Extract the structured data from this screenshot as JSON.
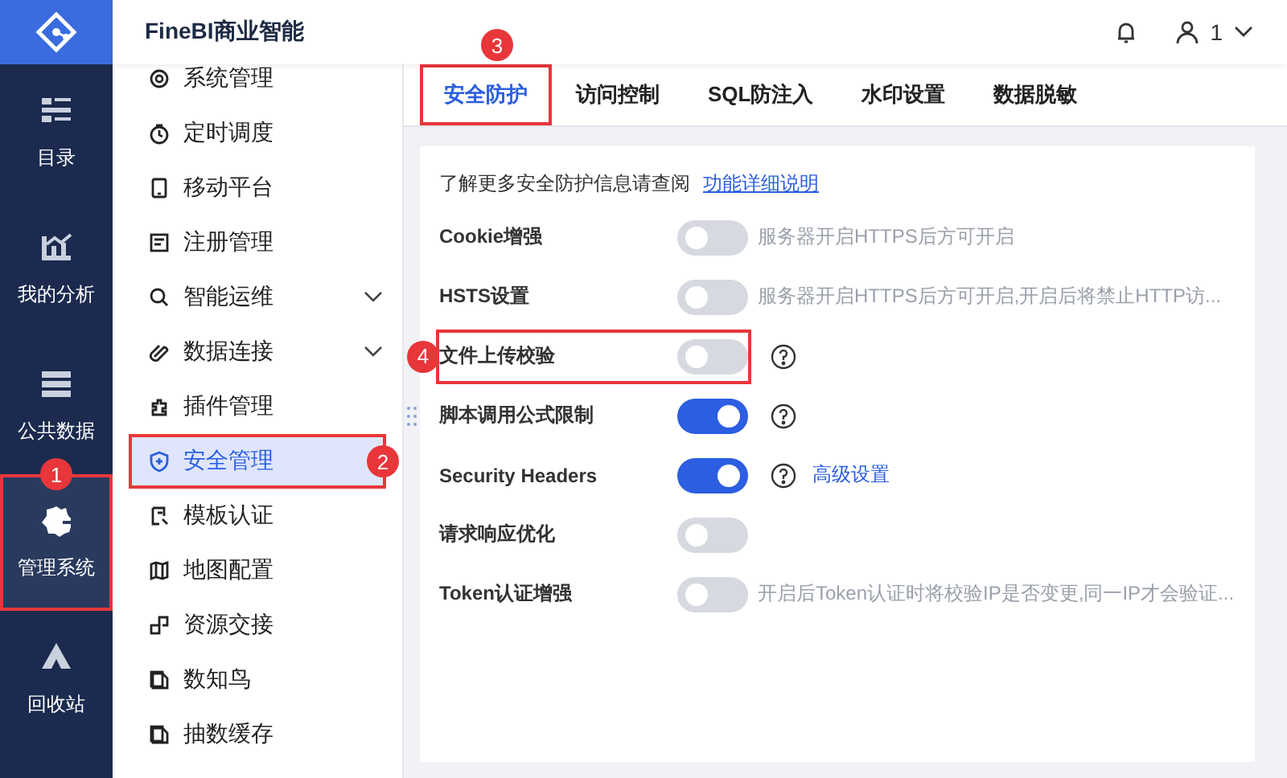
{
  "app": {
    "title": "FineBI商业智能"
  },
  "rail": [
    {
      "label": "目录",
      "selected": false,
      "highlighted": false
    },
    {
      "label": "我的分析",
      "selected": false,
      "highlighted": false
    },
    {
      "label": "公共数据",
      "selected": false,
      "highlighted": false
    },
    {
      "label": "管理系统",
      "selected": true,
      "highlighted": true,
      "badge": "1"
    },
    {
      "label": "回收站",
      "selected": false,
      "highlighted": false
    }
  ],
  "menu": [
    {
      "label": "系统管理",
      "kind": "page",
      "selected": false,
      "highlighted": false
    },
    {
      "label": "定时调度",
      "kind": "page",
      "selected": false,
      "highlighted": false
    },
    {
      "label": "移动平台",
      "kind": "page",
      "selected": false,
      "highlighted": false
    },
    {
      "label": "注册管理",
      "kind": "page",
      "selected": false,
      "highlighted": false
    },
    {
      "label": "智能运维",
      "kind": "group",
      "selected": false,
      "highlighted": false
    },
    {
      "label": "数据连接",
      "kind": "group",
      "selected": false,
      "highlighted": false
    },
    {
      "label": "插件管理",
      "kind": "page",
      "selected": false,
      "highlighted": false
    },
    {
      "label": "安全管理",
      "kind": "page",
      "selected": true,
      "highlighted": true,
      "badge": "2"
    },
    {
      "label": "模板认证",
      "kind": "page",
      "selected": false,
      "highlighted": false
    },
    {
      "label": "地图配置",
      "kind": "page",
      "selected": false,
      "highlighted": false
    },
    {
      "label": "资源交接",
      "kind": "page",
      "selected": false,
      "highlighted": false
    },
    {
      "label": "数知鸟",
      "kind": "page",
      "selected": false,
      "highlighted": false
    },
    {
      "label": "抽数缓存",
      "kind": "page",
      "selected": false,
      "highlighted": false
    }
  ],
  "user": {
    "name": "1"
  },
  "tabs": [
    {
      "label": "安全防护",
      "selected": true,
      "highlighted": true,
      "badge": "3"
    },
    {
      "label": "访问控制",
      "selected": false,
      "highlighted": false
    },
    {
      "label": "SQL防注入",
      "selected": false,
      "highlighted": false
    },
    {
      "label": "水印设置",
      "selected": false,
      "highlighted": false
    },
    {
      "label": "数据脱敏",
      "selected": false,
      "highlighted": false
    }
  ],
  "intro": {
    "text": "了解更多安全防护信息请查阅",
    "link": "功能详细说明"
  },
  "settings": [
    {
      "label": "Cookie增强",
      "on": false,
      "help": false,
      "highlighted": false,
      "hint": "服务器开启HTTPS后方可开启"
    },
    {
      "label": "HSTS设置",
      "on": false,
      "help": false,
      "highlighted": false,
      "hint": "服务器开启HTTPS后方可开启,开启后将禁止HTTP访..."
    },
    {
      "label": "文件上传校验",
      "on": false,
      "help": true,
      "highlighted": true,
      "badge": "4"
    },
    {
      "label": "脚本调用公式限制",
      "on": true,
      "help": true,
      "highlighted": false
    },
    {
      "label": "Security Headers",
      "on": true,
      "help": true,
      "highlighted": false,
      "link": "高级设置"
    },
    {
      "label": "请求响应优化",
      "on": false,
      "help": false,
      "highlighted": false
    },
    {
      "label": "Token认证增强",
      "on": false,
      "help": false,
      "highlighted": false,
      "hint": "开启后Token认证时将校验IP是否变更,同一IP才会验证..."
    }
  ]
}
